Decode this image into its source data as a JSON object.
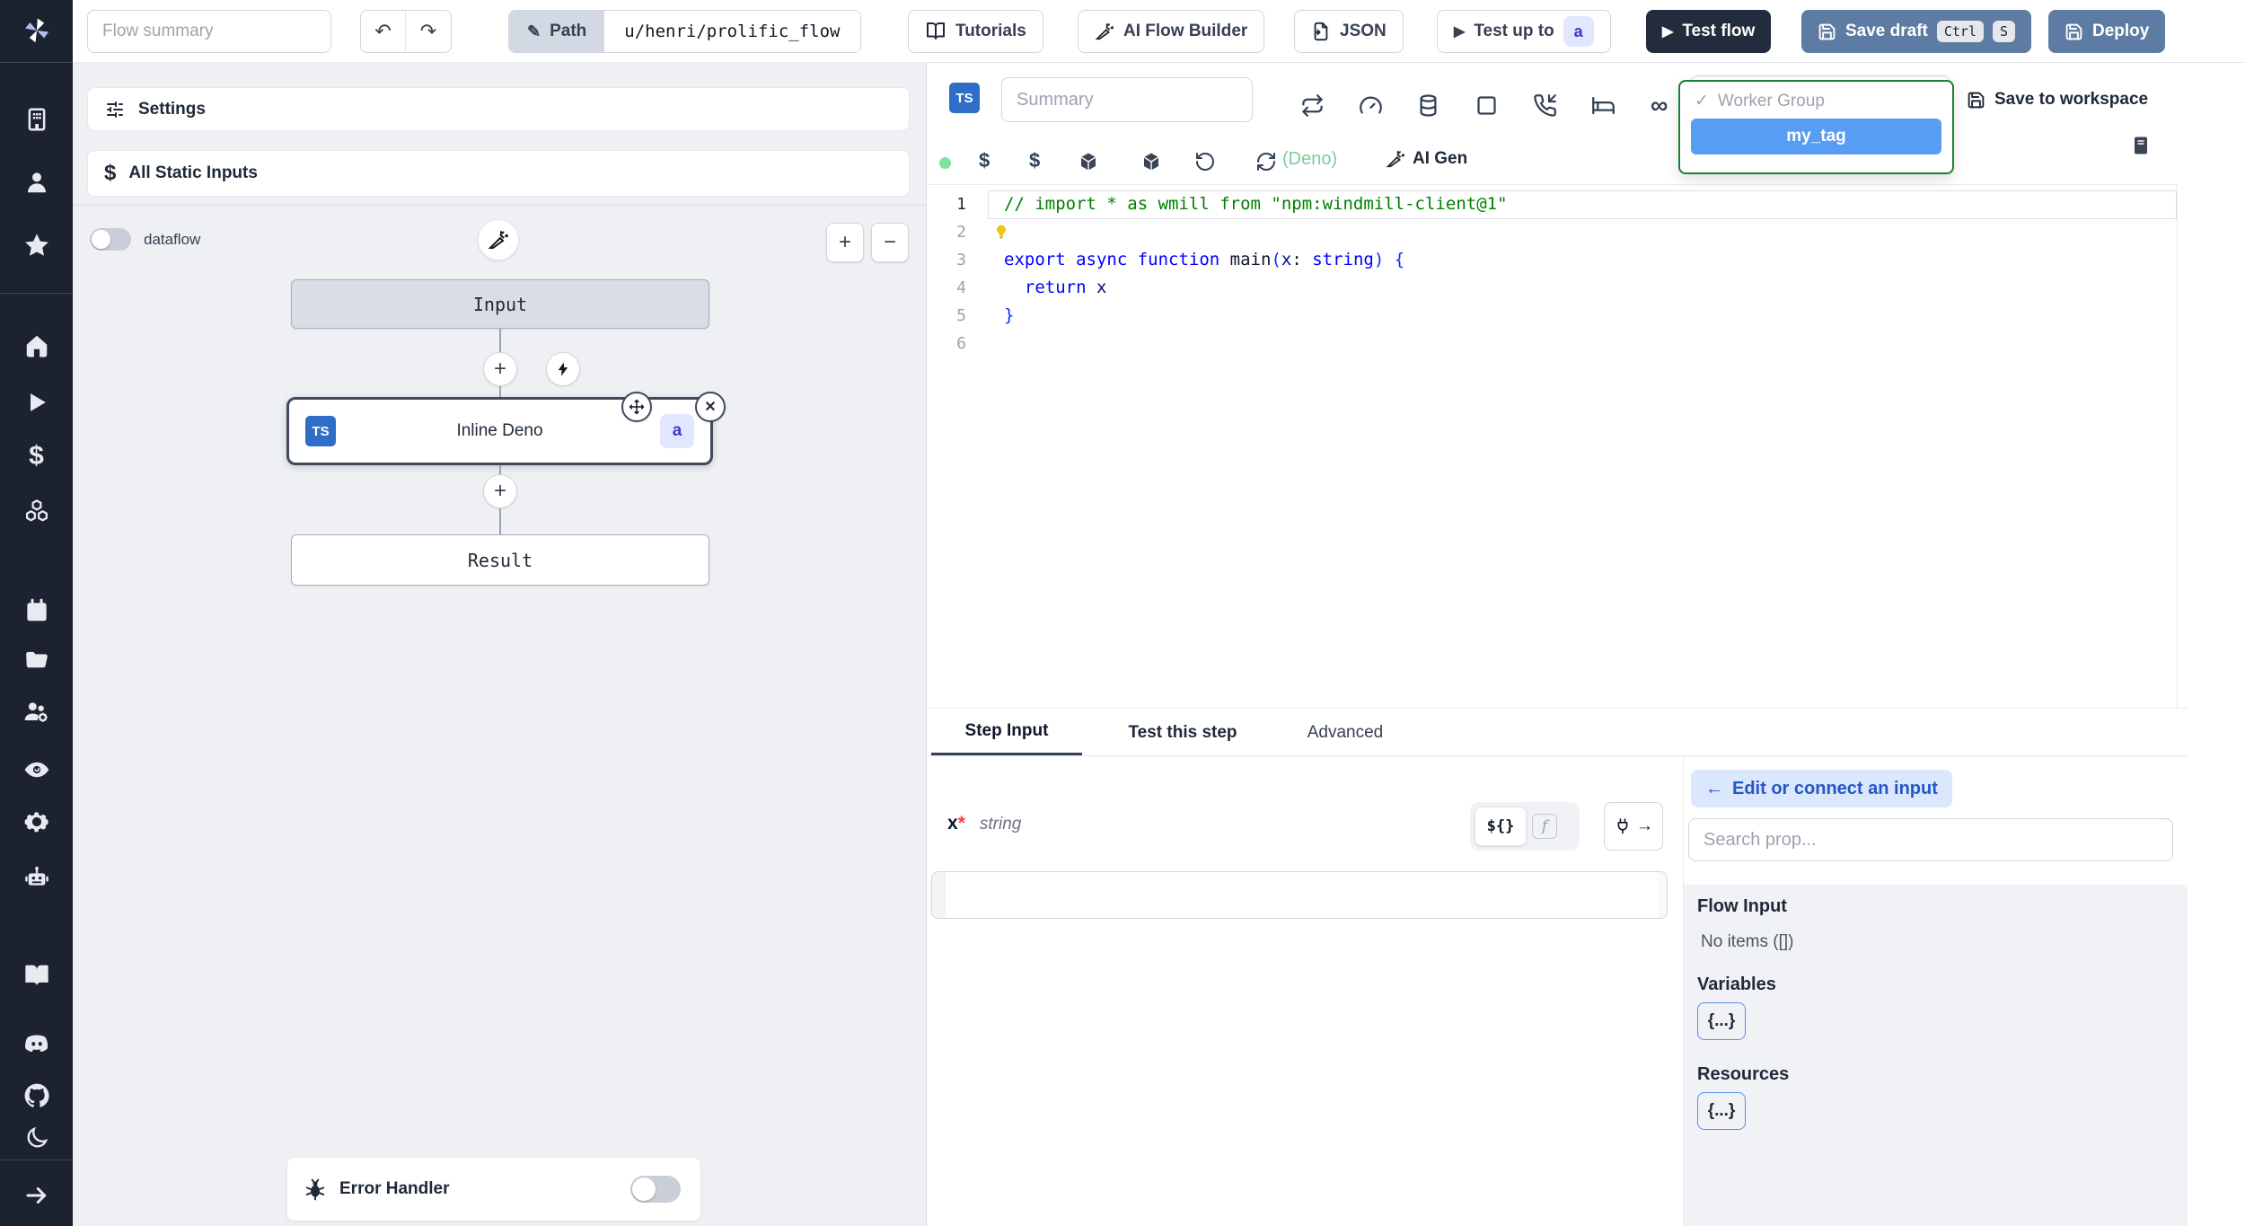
{
  "topbar": {
    "flow_summary_placeholder": "Flow summary",
    "path_label": "Path",
    "path_value": "u/henri/prolific_flow",
    "tutorials_label": "Tutorials",
    "ai_flow_builder_label": "AI Flow Builder",
    "json_label": "JSON",
    "test_up_to_label": "Test up to",
    "test_up_to_badge": "a",
    "test_flow_label": "Test flow",
    "save_draft_label": "Save draft",
    "kbd_ctrl": "Ctrl",
    "kbd_s": "S",
    "deploy_label": "Deploy"
  },
  "flow_panel": {
    "settings_label": "Settings",
    "all_static_inputs_label": "All Static Inputs",
    "dataflow_label": "dataflow",
    "zoom_in": "+",
    "zoom_out": "−",
    "input_node": "Input",
    "inline_deno_lang": "TS",
    "inline_deno_label": "Inline Deno",
    "inline_deno_badge": "a",
    "result_node": "Result",
    "error_handler_label": "Error Handler"
  },
  "editor_toolbar": {
    "lang_badge": "TS",
    "summary_placeholder": "Summary",
    "worker_group_check": "✓",
    "worker_group_label": "Worker Group",
    "selected_tag": "my_tag",
    "save_to_workspace_label": "Save to workspace",
    "runtime_label": "(Deno)",
    "ai_gen_label": "AI Gen"
  },
  "code": {
    "line_numbers": [
      "1",
      "2",
      "3",
      "4",
      "5",
      "6"
    ],
    "l1_comment": "// import * as wmill from \"npm:windmill-client@1\"",
    "l3": {
      "kw_export": "export ",
      "kw_async": "async ",
      "kw_function": "function ",
      "fn_name": "main",
      "paren_open": "(",
      "param": "x",
      "colon": ": ",
      "type": "string",
      "paren_close": ") ",
      "brace_open": "{"
    },
    "l4": {
      "kw_return": "  return ",
      "var": "x"
    },
    "l5_brace_close": "}"
  },
  "tabs": {
    "step_input": "Step Input",
    "test_this_step": "Test this step",
    "advanced": "Advanced"
  },
  "step_input": {
    "field_name": "x",
    "required_mark": "*",
    "field_type": "string",
    "expr_toggle": "${}",
    "fn_toggle": "f",
    "connect_arrow": "→"
  },
  "right_panel": {
    "back_arrow": "←",
    "edit_connect_label": "Edit or connect an input",
    "search_placeholder": "Search prop...",
    "flow_input_title": "Flow Input",
    "flow_input_empty": "No items ([])",
    "variables_title": "Variables",
    "variables_chip": "{...}",
    "resources_title": "Resources",
    "resources_chip": "{...}"
  },
  "colors": {
    "accent_button": "#5e7ca3",
    "dark_button": "#232c3d",
    "selected_tag_bg": "#579df3",
    "dropdown_border": "#1a7f37",
    "pill_bg": "#dbe7fd",
    "pill_text": "#2556c9",
    "badge_bg": "#e0e7ff",
    "badge_text": "#4338ca",
    "ts_badge_bg": "#2f6ec7",
    "runtime_green": "#7ccb9b"
  }
}
